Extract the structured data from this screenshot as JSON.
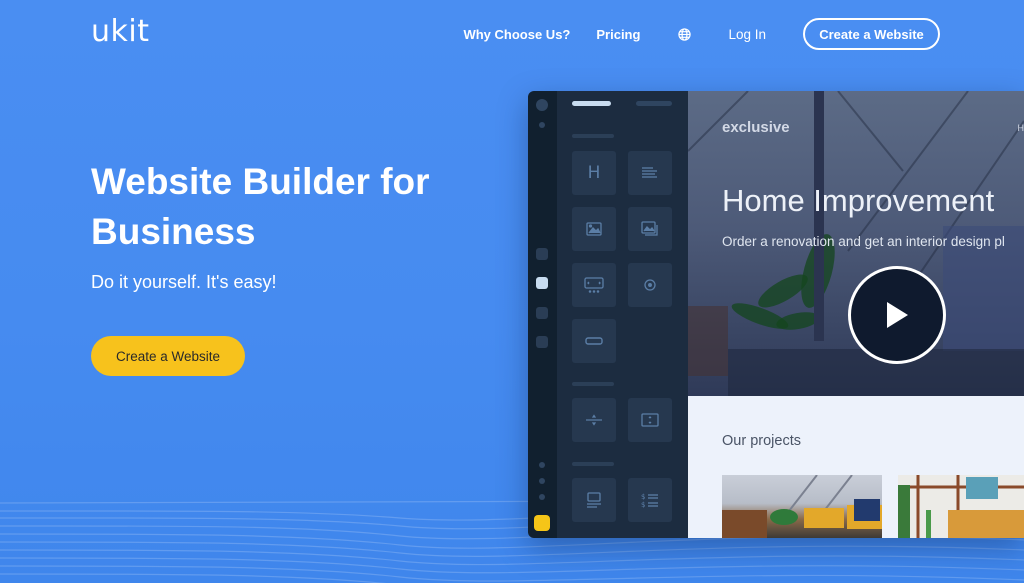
{
  "brand": {
    "logo": "ukit"
  },
  "nav": {
    "why_choose": "Why Choose Us?",
    "pricing": "Pricing",
    "language_icon": "globe-icon",
    "login": "Log In",
    "cta": "Create a Website"
  },
  "hero": {
    "title": "Website Builder for Business",
    "subtitle": "Do it yourself. It's easy!",
    "cta": "Create a Website"
  },
  "editor_mockup": {
    "panel_tiles": [
      {
        "icon": "heading-icon",
        "glyph": "H"
      },
      {
        "icon": "text-block-icon"
      },
      {
        "icon": "image-icon"
      },
      {
        "icon": "gallery-icon"
      },
      {
        "icon": "slider-icon"
      },
      {
        "icon": "video-icon"
      },
      {
        "icon": "button-icon"
      },
      {
        "icon": "divider-icon"
      },
      {
        "icon": "spacer-icon"
      },
      {
        "icon": "product-card-icon"
      },
      {
        "icon": "price-list-icon"
      }
    ],
    "preview": {
      "site_name": "exclusive",
      "menu_fragment": "H",
      "title": "Home Improvement",
      "subtitle": "Order a renovation and get an interior design pl",
      "play_icon": "play-icon",
      "section_title": "Our projects"
    }
  },
  "colors": {
    "background": "#4a8ef2",
    "cta_yellow": "#f7c21c",
    "editor_rail": "#11202f",
    "editor_panel": "#1c2c40",
    "tile": "#26384f"
  }
}
